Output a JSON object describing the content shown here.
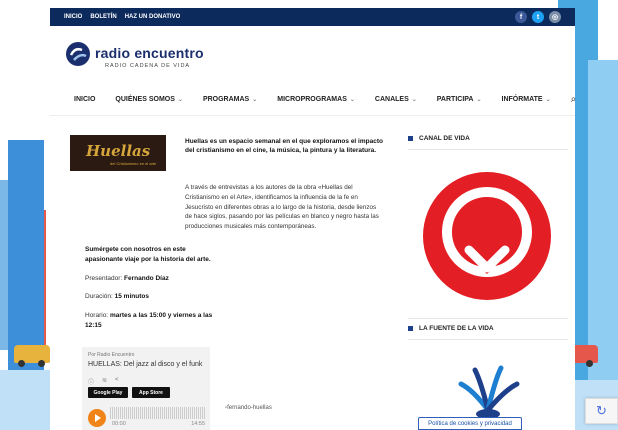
{
  "topbar": {
    "links": [
      "INICIO",
      "BOLETÍN",
      "HAZ UN DONATIVO"
    ],
    "social": [
      {
        "icon": "facebook-icon",
        "glyph": "f",
        "color": "#3b5998"
      },
      {
        "icon": "twitter-icon",
        "glyph": "t",
        "color": "#1da1f2"
      },
      {
        "icon": "instagram-icon",
        "glyph": "◎",
        "color": "#7a8ea8"
      }
    ]
  },
  "brand": {
    "title": "radio encuentro",
    "subtitle": "RADIO CADENA DE VIDA"
  },
  "nav": {
    "items": [
      {
        "label": "INICIO",
        "dropdown": false
      },
      {
        "label": "QUIÉNES SOMOS",
        "dropdown": true
      },
      {
        "label": "PROGRAMAS",
        "dropdown": true
      },
      {
        "label": "MICROPROGRAMAS",
        "dropdown": true
      },
      {
        "label": "CANALES",
        "dropdown": true
      },
      {
        "label": "PARTICIPA",
        "dropdown": true
      },
      {
        "label": "INFÓRMATE",
        "dropdown": true
      }
    ],
    "chevron": "⌄",
    "search_glyph": "⌕"
  },
  "program": {
    "image_title": "Huellas",
    "image_subtitle": "del Cristianismo en el arte",
    "intro": "Huellas es un espacio semanal en el que exploramos el impacto del cristianismo en el cine, la música, la pintura y la literatura.",
    "description": "A través de entrevistas a los autores de la obra «Huellas del Cristianismo en el Arte», identificamos la influencia de la fe en Jesucristo en diferentes obras a lo largo de la historia, desde lienzos de hace siglos, pasando por las películas en blanco y negro hasta las producciones musicales más contemporáneas.",
    "tagline": "Sumérgete con nosotros en este apasionante viaje por la historia del arte.",
    "presenter_label": "Presentador:",
    "presenter": "Fernando Díaz",
    "duration_label": "Duración:",
    "duration": "15 minutos",
    "schedule_label": "Horario:",
    "schedule": "martes a las 15:00 y viernes a las 12:15"
  },
  "player": {
    "by": "Por Radio Encuentro",
    "title": "HUELLAS: Del jazz al disco y el funk",
    "store_google": "Google Play",
    "store_apple": "App Store",
    "time_current": "00:00",
    "time_total": "14:55",
    "progress": 0
  },
  "broken_image_alt": "fernando-huellas",
  "sidebar": {
    "canal_heading": "CANAL DE VIDA",
    "fuente_heading": "LA FUENTE DE LA VIDA",
    "accent": "#e31e24",
    "brand_blue": "#1e3f8a"
  },
  "cookie_label": "Política de cookies y privacidad"
}
